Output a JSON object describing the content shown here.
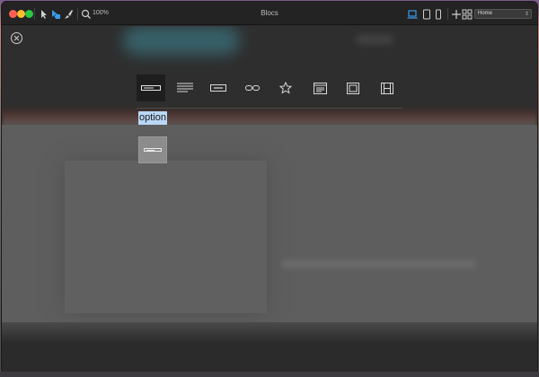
{
  "window": {
    "title": "Blocs"
  },
  "toolbar": {
    "zoom_label": "100%",
    "page_select": {
      "value": "Home"
    },
    "icons": [
      "select-cursor-icon",
      "blocks-icon",
      "brush-icon",
      "zoom-icon",
      "laptop-icon",
      "tablet-icon",
      "phone-icon",
      "add-icon",
      "grid-icon"
    ]
  },
  "block_picker": {
    "categories": [
      {
        "name": "form-field",
        "active": true
      },
      {
        "name": "text"
      },
      {
        "name": "button"
      },
      {
        "name": "link"
      },
      {
        "name": "star"
      },
      {
        "name": "window"
      },
      {
        "name": "image"
      },
      {
        "name": "video"
      }
    ],
    "option_label": "option"
  },
  "colors": {
    "selection_highlight": "#b9d7f7",
    "active_toolbar_icon": "#3a9ae8"
  }
}
